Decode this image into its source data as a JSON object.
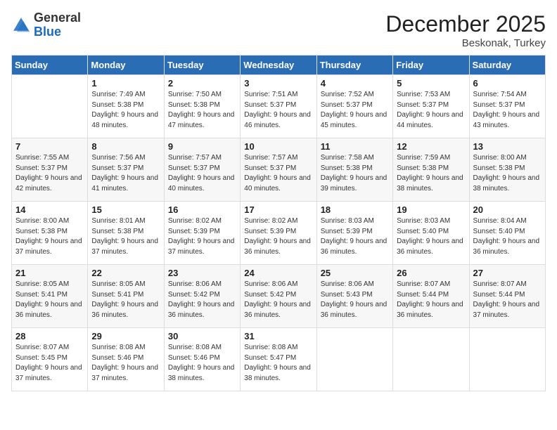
{
  "logo": {
    "general": "General",
    "blue": "Blue"
  },
  "header": {
    "month": "December 2025",
    "location": "Beskonak, Turkey"
  },
  "weekdays": [
    "Sunday",
    "Monday",
    "Tuesday",
    "Wednesday",
    "Thursday",
    "Friday",
    "Saturday"
  ],
  "weeks": [
    [
      {
        "day": "",
        "sunrise": "",
        "sunset": "",
        "daylight": ""
      },
      {
        "day": "1",
        "sunrise": "7:49 AM",
        "sunset": "5:38 PM",
        "daylight": "9 hours and 48 minutes."
      },
      {
        "day": "2",
        "sunrise": "7:50 AM",
        "sunset": "5:38 PM",
        "daylight": "9 hours and 47 minutes."
      },
      {
        "day": "3",
        "sunrise": "7:51 AM",
        "sunset": "5:37 PM",
        "daylight": "9 hours and 46 minutes."
      },
      {
        "day": "4",
        "sunrise": "7:52 AM",
        "sunset": "5:37 PM",
        "daylight": "9 hours and 45 minutes."
      },
      {
        "day": "5",
        "sunrise": "7:53 AM",
        "sunset": "5:37 PM",
        "daylight": "9 hours and 44 minutes."
      },
      {
        "day": "6",
        "sunrise": "7:54 AM",
        "sunset": "5:37 PM",
        "daylight": "9 hours and 43 minutes."
      }
    ],
    [
      {
        "day": "7",
        "sunrise": "7:55 AM",
        "sunset": "5:37 PM",
        "daylight": "9 hours and 42 minutes."
      },
      {
        "day": "8",
        "sunrise": "7:56 AM",
        "sunset": "5:37 PM",
        "daylight": "9 hours and 41 minutes."
      },
      {
        "day": "9",
        "sunrise": "7:57 AM",
        "sunset": "5:37 PM",
        "daylight": "9 hours and 40 minutes."
      },
      {
        "day": "10",
        "sunrise": "7:57 AM",
        "sunset": "5:37 PM",
        "daylight": "9 hours and 40 minutes."
      },
      {
        "day": "11",
        "sunrise": "7:58 AM",
        "sunset": "5:38 PM",
        "daylight": "9 hours and 39 minutes."
      },
      {
        "day": "12",
        "sunrise": "7:59 AM",
        "sunset": "5:38 PM",
        "daylight": "9 hours and 38 minutes."
      },
      {
        "day": "13",
        "sunrise": "8:00 AM",
        "sunset": "5:38 PM",
        "daylight": "9 hours and 38 minutes."
      }
    ],
    [
      {
        "day": "14",
        "sunrise": "8:00 AM",
        "sunset": "5:38 PM",
        "daylight": "9 hours and 37 minutes."
      },
      {
        "day": "15",
        "sunrise": "8:01 AM",
        "sunset": "5:38 PM",
        "daylight": "9 hours and 37 minutes."
      },
      {
        "day": "16",
        "sunrise": "8:02 AM",
        "sunset": "5:39 PM",
        "daylight": "9 hours and 37 minutes."
      },
      {
        "day": "17",
        "sunrise": "8:02 AM",
        "sunset": "5:39 PM",
        "daylight": "9 hours and 36 minutes."
      },
      {
        "day": "18",
        "sunrise": "8:03 AM",
        "sunset": "5:39 PM",
        "daylight": "9 hours and 36 minutes."
      },
      {
        "day": "19",
        "sunrise": "8:03 AM",
        "sunset": "5:40 PM",
        "daylight": "9 hours and 36 minutes."
      },
      {
        "day": "20",
        "sunrise": "8:04 AM",
        "sunset": "5:40 PM",
        "daylight": "9 hours and 36 minutes."
      }
    ],
    [
      {
        "day": "21",
        "sunrise": "8:05 AM",
        "sunset": "5:41 PM",
        "daylight": "9 hours and 36 minutes."
      },
      {
        "day": "22",
        "sunrise": "8:05 AM",
        "sunset": "5:41 PM",
        "daylight": "9 hours and 36 minutes."
      },
      {
        "day": "23",
        "sunrise": "8:06 AM",
        "sunset": "5:42 PM",
        "daylight": "9 hours and 36 minutes."
      },
      {
        "day": "24",
        "sunrise": "8:06 AM",
        "sunset": "5:42 PM",
        "daylight": "9 hours and 36 minutes."
      },
      {
        "day": "25",
        "sunrise": "8:06 AM",
        "sunset": "5:43 PM",
        "daylight": "9 hours and 36 minutes."
      },
      {
        "day": "26",
        "sunrise": "8:07 AM",
        "sunset": "5:44 PM",
        "daylight": "9 hours and 36 minutes."
      },
      {
        "day": "27",
        "sunrise": "8:07 AM",
        "sunset": "5:44 PM",
        "daylight": "9 hours and 37 minutes."
      }
    ],
    [
      {
        "day": "28",
        "sunrise": "8:07 AM",
        "sunset": "5:45 PM",
        "daylight": "9 hours and 37 minutes."
      },
      {
        "day": "29",
        "sunrise": "8:08 AM",
        "sunset": "5:46 PM",
        "daylight": "9 hours and 37 minutes."
      },
      {
        "day": "30",
        "sunrise": "8:08 AM",
        "sunset": "5:46 PM",
        "daylight": "9 hours and 38 minutes."
      },
      {
        "day": "31",
        "sunrise": "8:08 AM",
        "sunset": "5:47 PM",
        "daylight": "9 hours and 38 minutes."
      },
      {
        "day": "",
        "sunrise": "",
        "sunset": "",
        "daylight": ""
      },
      {
        "day": "",
        "sunrise": "",
        "sunset": "",
        "daylight": ""
      },
      {
        "day": "",
        "sunrise": "",
        "sunset": "",
        "daylight": ""
      }
    ]
  ]
}
